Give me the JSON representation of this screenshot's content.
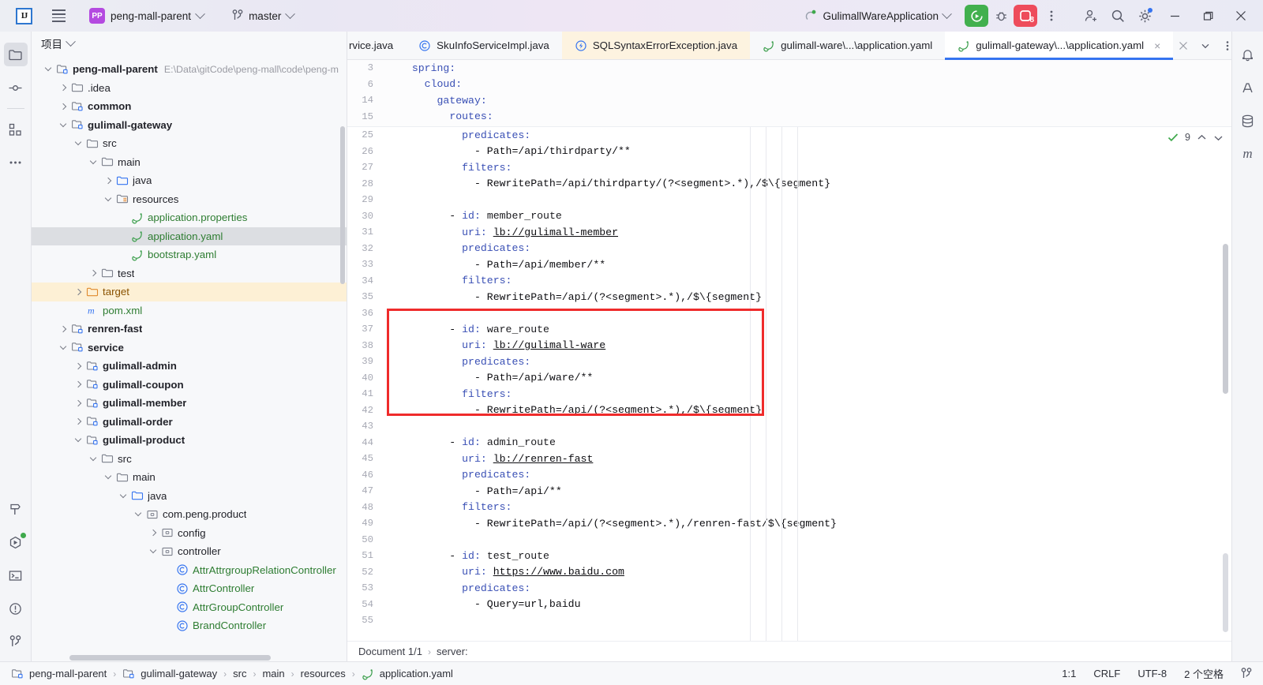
{
  "titlebar": {
    "ij_logo": "IJ",
    "project_name": "peng-mall-parent",
    "branch_name": "master",
    "run_config": "GulimallWareApplication",
    "stop_count": "8",
    "icons": {
      "menu": "hamburger-icon",
      "project_badge": "PP",
      "branch": "git-branch-icon",
      "run": "run-icon",
      "debug": "debug-icon",
      "stop": "stop-icon",
      "more": "more-vertical-icon",
      "add_user": "add-user-icon",
      "search": "search-icon",
      "settings": "gear-icon",
      "minimize": "minimize-icon",
      "maximize": "maximize-icon",
      "close": "close-icon"
    }
  },
  "rail": {
    "top": [
      {
        "name": "project-tool-window",
        "icon": "folder-icon",
        "active": true
      },
      {
        "name": "commit-tool-window",
        "icon": "commit-icon",
        "active": false
      },
      {
        "name": "structure-tool-window",
        "icon": "structure-icon",
        "active": false
      },
      {
        "name": "more-tool-windows",
        "icon": "ellipsis-icon",
        "active": false
      }
    ],
    "bottom": [
      {
        "name": "build-tool-window",
        "icon": "hammer-icon",
        "active": false
      },
      {
        "name": "services-tool-window",
        "icon": "services-icon",
        "active": false
      },
      {
        "name": "terminal-tool-window",
        "icon": "terminal-icon",
        "active": false
      },
      {
        "name": "problems-tool-window",
        "icon": "warning-icon",
        "active": false
      },
      {
        "name": "git-tool-window",
        "icon": "git-branch-icon",
        "active": false
      }
    ]
  },
  "rail_right": [
    {
      "name": "notifications",
      "icon": "bell-icon"
    },
    {
      "name": "ai-assistant",
      "icon": "ai-icon"
    },
    {
      "name": "database",
      "icon": "database-icon"
    },
    {
      "name": "maven",
      "icon": "maven-m-icon"
    }
  ],
  "project_panel": {
    "header": "项目",
    "tree": [
      {
        "depth": 0,
        "arrow": "down",
        "icon": "module-icon",
        "label": "peng-mall-parent",
        "bold": true,
        "path": "E:\\Data\\gitCode\\peng-mall\\code\\peng-m",
        "state": "normal"
      },
      {
        "depth": 1,
        "arrow": "right",
        "icon": "folder-icon",
        "label": ".idea",
        "bold": false,
        "path": "",
        "state": "normal"
      },
      {
        "depth": 1,
        "arrow": "right",
        "icon": "module-icon",
        "label": "common",
        "bold": true,
        "path": "",
        "state": "normal"
      },
      {
        "depth": 1,
        "arrow": "down",
        "icon": "module-icon",
        "label": "gulimall-gateway",
        "bold": true,
        "path": "",
        "state": "normal"
      },
      {
        "depth": 2,
        "arrow": "down",
        "icon": "folder-icon",
        "label": "src",
        "bold": false,
        "path": "",
        "state": "normal"
      },
      {
        "depth": 3,
        "arrow": "down",
        "icon": "folder-icon",
        "label": "main",
        "bold": false,
        "path": "",
        "state": "normal"
      },
      {
        "depth": 4,
        "arrow": "right",
        "icon": "source-folder-icon",
        "label": "java",
        "bold": false,
        "path": "",
        "state": "normal"
      },
      {
        "depth": 4,
        "arrow": "down",
        "icon": "resource-folder-icon",
        "label": "resources",
        "bold": false,
        "path": "",
        "state": "normal"
      },
      {
        "depth": 5,
        "arrow": "none",
        "icon": "spring-leaf-icon",
        "label": "application.properties",
        "bold": false,
        "path": "",
        "state": "green"
      },
      {
        "depth": 5,
        "arrow": "none",
        "icon": "spring-leaf-icon",
        "label": "application.yaml",
        "bold": false,
        "path": "",
        "state": "green-selected"
      },
      {
        "depth": 5,
        "arrow": "none",
        "icon": "spring-leaf-icon",
        "label": "bootstrap.yaml",
        "bold": false,
        "path": "",
        "state": "green"
      },
      {
        "depth": 3,
        "arrow": "right",
        "icon": "folder-icon",
        "label": "test",
        "bold": false,
        "path": "",
        "state": "normal"
      },
      {
        "depth": 2,
        "arrow": "right",
        "icon": "excluded-folder-icon",
        "label": "target",
        "bold": false,
        "path": "",
        "state": "orange-highlight"
      },
      {
        "depth": 2,
        "arrow": "none",
        "icon": "maven-m-icon",
        "label": "pom.xml",
        "bold": false,
        "path": "",
        "state": "green"
      },
      {
        "depth": 1,
        "arrow": "right",
        "icon": "module-icon",
        "label": "renren-fast",
        "bold": true,
        "path": "",
        "state": "normal"
      },
      {
        "depth": 1,
        "arrow": "down",
        "icon": "module-icon",
        "label": "service",
        "bold": true,
        "path": "",
        "state": "normal"
      },
      {
        "depth": 2,
        "arrow": "right",
        "icon": "module-icon",
        "label": "gulimall-admin",
        "bold": true,
        "path": "",
        "state": "normal"
      },
      {
        "depth": 2,
        "arrow": "right",
        "icon": "module-icon",
        "label": "gulimall-coupon",
        "bold": true,
        "path": "",
        "state": "normal"
      },
      {
        "depth": 2,
        "arrow": "right",
        "icon": "module-icon",
        "label": "gulimall-member",
        "bold": true,
        "path": "",
        "state": "normal"
      },
      {
        "depth": 2,
        "arrow": "right",
        "icon": "module-icon",
        "label": "gulimall-order",
        "bold": true,
        "path": "",
        "state": "normal"
      },
      {
        "depth": 2,
        "arrow": "down",
        "icon": "module-icon",
        "label": "gulimall-product",
        "bold": true,
        "path": "",
        "state": "normal"
      },
      {
        "depth": 3,
        "arrow": "down",
        "icon": "folder-icon",
        "label": "src",
        "bold": false,
        "path": "",
        "state": "normal"
      },
      {
        "depth": 4,
        "arrow": "down",
        "icon": "folder-icon",
        "label": "main",
        "bold": false,
        "path": "",
        "state": "normal"
      },
      {
        "depth": 5,
        "arrow": "down",
        "icon": "source-folder-icon",
        "label": "java",
        "bold": false,
        "path": "",
        "state": "normal"
      },
      {
        "depth": 6,
        "arrow": "down",
        "icon": "package-icon",
        "label": "com.peng.product",
        "bold": false,
        "path": "",
        "state": "normal"
      },
      {
        "depth": 7,
        "arrow": "right",
        "icon": "package-icon",
        "label": "config",
        "bold": false,
        "path": "",
        "state": "normal"
      },
      {
        "depth": 7,
        "arrow": "down",
        "icon": "package-icon",
        "label": "controller",
        "bold": false,
        "path": "",
        "state": "normal"
      },
      {
        "depth": 8,
        "arrow": "none",
        "icon": "class-icon",
        "label": "AttrAttrgroupRelationController",
        "bold": false,
        "path": "",
        "state": "green"
      },
      {
        "depth": 8,
        "arrow": "none",
        "icon": "class-icon",
        "label": "AttrController",
        "bold": false,
        "path": "",
        "state": "green"
      },
      {
        "depth": 8,
        "arrow": "none",
        "icon": "class-icon",
        "label": "AttrGroupController",
        "bold": false,
        "path": "",
        "state": "green"
      },
      {
        "depth": 8,
        "arrow": "none",
        "icon": "class-icon",
        "label": "BrandController",
        "bold": false,
        "path": "",
        "state": "green"
      }
    ]
  },
  "editor": {
    "tabs": [
      {
        "label": "rvice.java",
        "icon": "none",
        "state": "clipped"
      },
      {
        "label": "SkuInfoServiceImpl.java",
        "icon": "class-icon",
        "state": "normal"
      },
      {
        "label": "SQLSyntaxErrorException.java",
        "icon": "exception-class-icon",
        "state": "amber"
      },
      {
        "label": "gulimall-ware\\...\\application.yaml",
        "icon": "spring-leaf-icon",
        "state": "normal"
      },
      {
        "label": "gulimall-gateway\\...\\application.yaml",
        "icon": "spring-leaf-icon",
        "state": "active"
      }
    ],
    "tab_controls": [
      {
        "name": "tab-close-button",
        "icon": "close-icon"
      },
      {
        "name": "tab-list-button",
        "icon": "chevron-down-icon"
      },
      {
        "name": "tab-options-button",
        "icon": "more-vertical-icon"
      }
    ],
    "inspection": {
      "count": "9",
      "icon": "inspection-check-icon"
    },
    "sticky_lines": [
      {
        "num": "3",
        "indent": 2,
        "text": "spring:",
        "kind": "key"
      },
      {
        "num": "6",
        "indent": 4,
        "text": "cloud:",
        "kind": "key"
      },
      {
        "num": "14",
        "indent": 6,
        "text": "gateway:",
        "kind": "key"
      },
      {
        "num": "15",
        "indent": 8,
        "text": "routes:",
        "kind": "key"
      }
    ],
    "lines": [
      {
        "num": "25",
        "text": "          predicates:"
      },
      {
        "num": "26",
        "text": "            - Path=/api/thirdparty/**"
      },
      {
        "num": "27",
        "text": "          filters:"
      },
      {
        "num": "28",
        "text": "            - RewritePath=/api/thirdparty/(?<segment>.*),/$\\{segment}"
      },
      {
        "num": "29",
        "text": ""
      },
      {
        "num": "30",
        "text": "        - id: member_route"
      },
      {
        "num": "31",
        "text": "          uri: lb://gulimall-member"
      },
      {
        "num": "32",
        "text": "          predicates:"
      },
      {
        "num": "33",
        "text": "            - Path=/api/member/**"
      },
      {
        "num": "34",
        "text": "          filters:"
      },
      {
        "num": "35",
        "text": "            - RewritePath=/api/(?<segment>.*),/$\\{segment}"
      },
      {
        "num": "36",
        "text": ""
      },
      {
        "num": "37",
        "text": "        - id: ware_route"
      },
      {
        "num": "38",
        "text": "          uri: lb://gulimall-ware"
      },
      {
        "num": "39",
        "text": "          predicates:"
      },
      {
        "num": "40",
        "text": "            - Path=/api/ware/**"
      },
      {
        "num": "41",
        "text": "          filters:"
      },
      {
        "num": "42",
        "text": "            - RewritePath=/api/(?<segment>.*),/$\\{segment}"
      },
      {
        "num": "43",
        "text": ""
      },
      {
        "num": "44",
        "text": "        - id: admin_route"
      },
      {
        "num": "45",
        "text": "          uri: lb://renren-fast"
      },
      {
        "num": "46",
        "text": "          predicates:"
      },
      {
        "num": "47",
        "text": "            - Path=/api/**"
      },
      {
        "num": "48",
        "text": "          filters:"
      },
      {
        "num": "49",
        "text": "            - RewritePath=/api/(?<segment>.*),/renren-fast/$\\{segment}"
      },
      {
        "num": "50",
        "text": ""
      },
      {
        "num": "51",
        "text": "        - id: test_route"
      },
      {
        "num": "52",
        "text": "          uri: https://www.baidu.com"
      },
      {
        "num": "53",
        "text": "          predicates:"
      },
      {
        "num": "54",
        "text": "            - Query=url,baidu"
      },
      {
        "num": "55",
        "text": ""
      }
    ],
    "highlight_box": {
      "color": "#ef2b2b",
      "from_line": "37",
      "to_line": "42"
    },
    "breadcrumb": {
      "document": "Document 1/1",
      "node": "server:"
    }
  },
  "statusbar": {
    "left_crumbs": [
      {
        "label": "peng-mall-parent",
        "icon": "module-icon"
      },
      {
        "label": "gulimall-gateway",
        "icon": "module-icon"
      },
      {
        "label": "src",
        "icon": "none"
      },
      {
        "label": "main",
        "icon": "none"
      },
      {
        "label": "resources",
        "icon": "none"
      },
      {
        "label": "application.yaml",
        "icon": "spring-leaf-icon"
      }
    ],
    "right": {
      "caret": "1:1",
      "line_sep": "CRLF",
      "encoding": "UTF-8",
      "indent": "2 个空格",
      "branch_icon": "git-branch-icon"
    }
  },
  "colors": {
    "accent_blue": "#3574f0",
    "run_green": "#42b04e",
    "stop_red": "#ee4c5b",
    "highlight_red": "#ef2b2b",
    "module_purple": "#b44ae0",
    "tab_amber": "#fdf3e0",
    "selection_grey": "#dcdee2"
  }
}
